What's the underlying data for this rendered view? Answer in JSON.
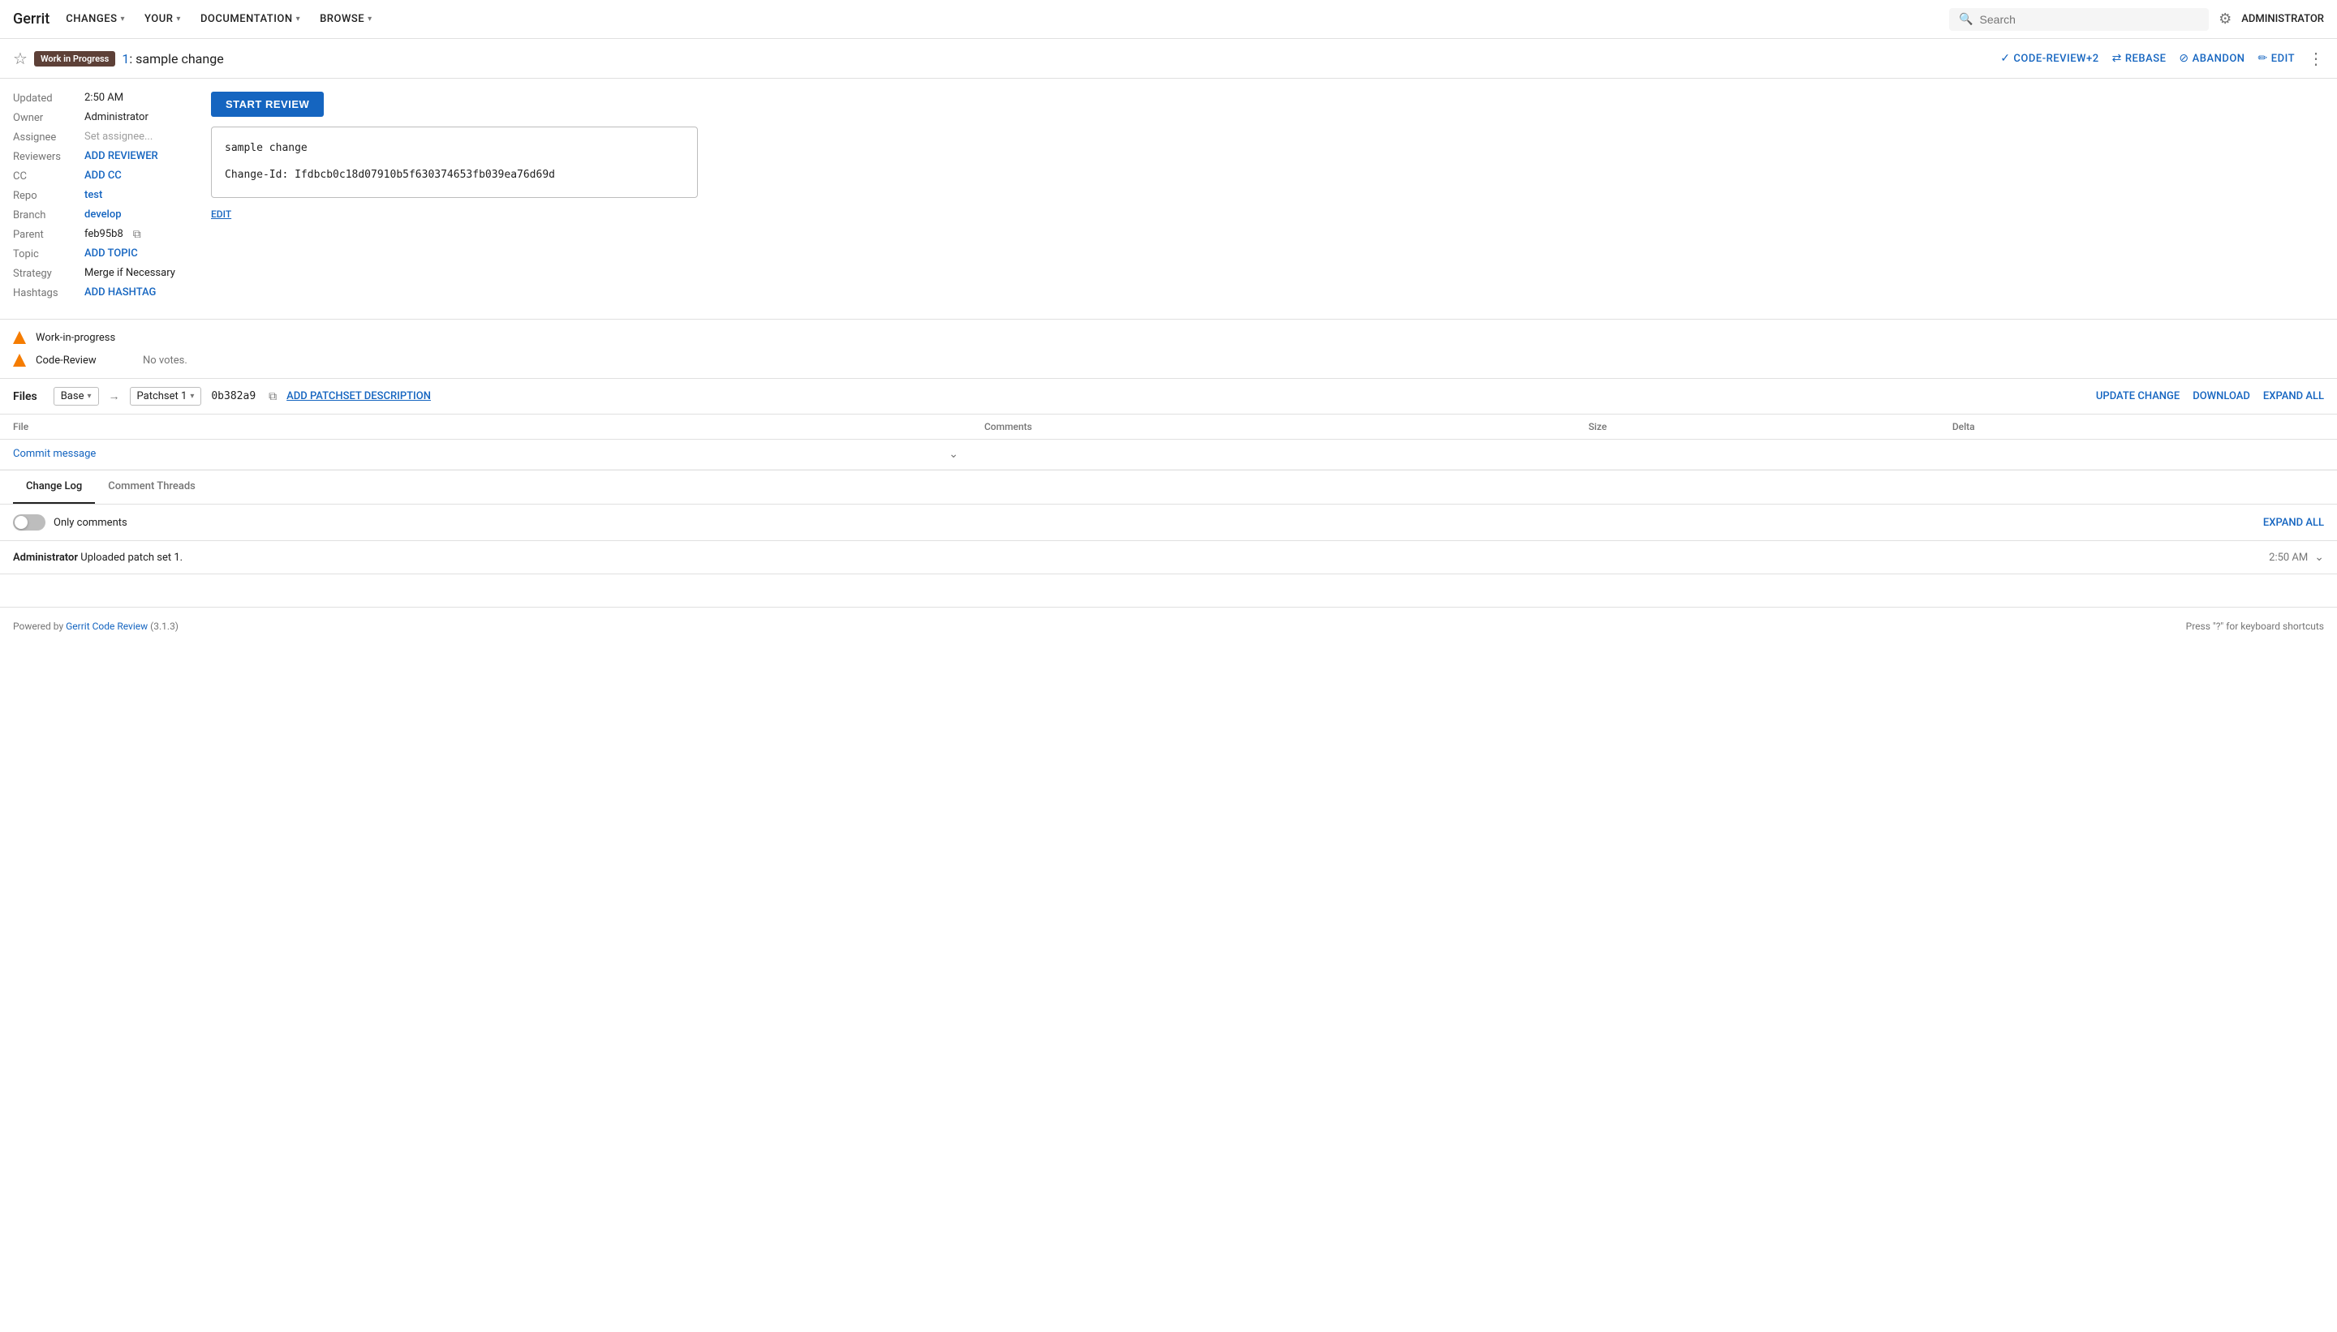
{
  "nav": {
    "brand": "Gerrit",
    "items": [
      {
        "label": "CHANGES",
        "id": "changes"
      },
      {
        "label": "YOUR",
        "id": "your"
      },
      {
        "label": "DOCUMENTATION",
        "id": "documentation"
      },
      {
        "label": "BROWSE",
        "id": "browse"
      }
    ],
    "search_placeholder": "Search",
    "admin_label": "ADMINISTRATOR"
  },
  "change_header": {
    "wip_badge": "Work in Progress",
    "change_number": "1",
    "change_title": "sample change",
    "actions": {
      "code_review": "CODE-REVIEW+2",
      "rebase": "REBASE",
      "abandon": "ABANDON",
      "edit": "EDIT"
    }
  },
  "meta": {
    "updated_label": "Updated",
    "updated_value": "2:50 AM",
    "owner_label": "Owner",
    "owner_value": "Administrator",
    "assignee_label": "Assignee",
    "assignee_value": "Set assignee...",
    "reviewers_label": "Reviewers",
    "reviewers_action": "ADD REVIEWER",
    "cc_label": "CC",
    "cc_action": "ADD CC",
    "repo_label": "Repo",
    "repo_value": "test",
    "branch_label": "Branch",
    "branch_value": "develop",
    "parent_label": "Parent",
    "parent_value": "feb95b8",
    "topic_label": "Topic",
    "topic_action": "ADD TOPIC",
    "strategy_label": "Strategy",
    "strategy_value": "Merge if Necessary",
    "hashtags_label": "Hashtags",
    "hashtags_action": "ADD HASHTAG"
  },
  "description": {
    "start_review_btn": "START REVIEW",
    "commit_message_line1": "sample change",
    "commit_message_line2": "",
    "commit_message_line3": "Change-Id: Ifdbcb0c18d07910b5f630374653fb039ea76d69d",
    "edit_link": "EDIT"
  },
  "labels": [
    {
      "name": "Work-in-progress",
      "votes": ""
    },
    {
      "name": "Code-Review",
      "votes": "No votes."
    }
  ],
  "files": {
    "title": "Files",
    "base_selector": "Base",
    "patchset_selector": "Patchset 1",
    "commit_hash": "0b382a9",
    "add_patchset_link": "ADD PATCHSET DESCRIPTION",
    "actions": {
      "update_change": "UPDATE CHANGE",
      "download": "DOWNLOAD",
      "expand_all": "EXPAND ALL"
    },
    "columns": {
      "file": "File",
      "comments": "Comments",
      "size": "Size",
      "delta": "Delta"
    },
    "rows": [
      {
        "name": "Commit message",
        "comments": "",
        "size": "",
        "delta": ""
      }
    ]
  },
  "change_log": {
    "tabs": [
      "Change Log",
      "Comment Threads"
    ],
    "active_tab": "Change Log",
    "only_comments_label": "Only comments",
    "expand_all_link": "EXPAND ALL",
    "entries": [
      {
        "user": "Administrator",
        "action": "Uploaded patch set 1.",
        "time": "2:50 AM"
      }
    ]
  },
  "footer": {
    "powered_by_text": "Powered by ",
    "powered_by_link": "Gerrit Code Review",
    "version": "(3.1.3)",
    "keyboard_hint": "Press \"?\" for keyboard shortcuts"
  }
}
